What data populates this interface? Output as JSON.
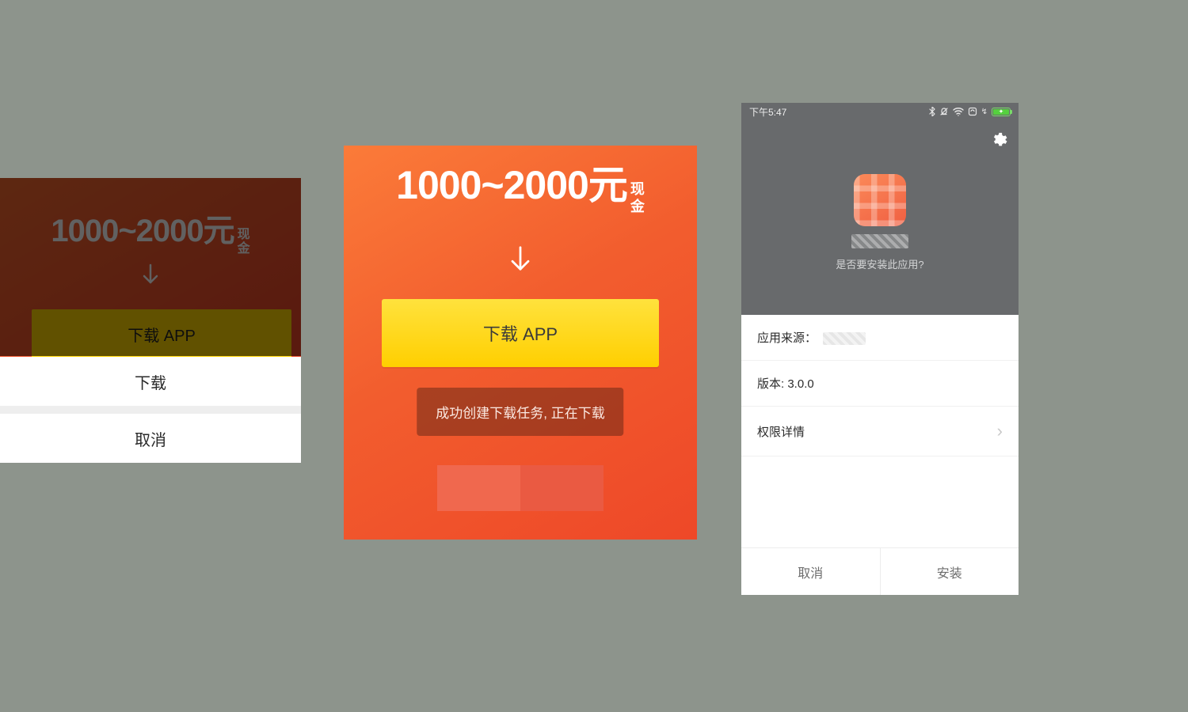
{
  "promo": {
    "headline_amount": "1000~2000元",
    "headline_suffix_top": "现",
    "headline_suffix_bottom": "金",
    "download_button": "下载 APP",
    "toast_message": "成功创建下载任务, 正在下载"
  },
  "action_sheet": {
    "download": "下载",
    "cancel": "取消"
  },
  "installer": {
    "status_time": "下午5:47",
    "prompt": "是否要安装此应用?",
    "rows": {
      "source_label": "应用来源：",
      "version_label": "版本: ",
      "version_value": "3.0.0",
      "permissions_label": "权限详情"
    },
    "footer": {
      "cancel": "取消",
      "install": "安装"
    }
  }
}
